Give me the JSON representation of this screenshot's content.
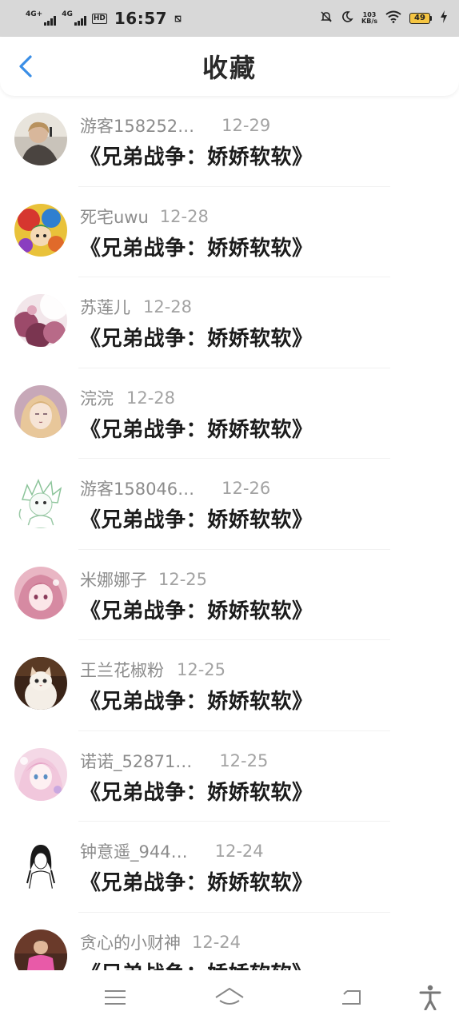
{
  "status_bar": {
    "net1": "4G+",
    "net2": "4G",
    "hd": "HD",
    "time": "16:57",
    "extra": "⧅",
    "speed_value": "103",
    "speed_unit": "KB/s",
    "battery": "49"
  },
  "header": {
    "title": "收藏",
    "back_icon": "chevron-left-icon",
    "accent": "#3a8ee6"
  },
  "items": [
    {
      "user": "游客158252…",
      "date": "12-29",
      "title": "《兄弟战争：娇娇软软》",
      "avatar": "avatar-photo-person"
    },
    {
      "user": "死宅uwu",
      "date": "12-28",
      "title": "《兄弟战争：娇娇软软》",
      "avatar": "avatar-colorful-anime"
    },
    {
      "user": "苏莲儿",
      "date": "12-28",
      "title": "《兄弟战争：娇娇软软》",
      "avatar": "avatar-pink-blossom"
    },
    {
      "user": "浣浣",
      "date": "12-28",
      "title": "《兄弟战争：娇娇软软》",
      "avatar": "avatar-anime-girl"
    },
    {
      "user": "游客158046…",
      "date": "12-26",
      "title": "《兄弟战争：娇娇软软》",
      "avatar": "avatar-sketch-character"
    },
    {
      "user": "米娜娜子",
      "date": "12-25",
      "title": "《兄弟战争：娇娇软软》",
      "avatar": "avatar-pink-anime"
    },
    {
      "user": "王兰花椒粉",
      "date": "12-25",
      "title": "《兄弟战争：娇娇软软》",
      "avatar": "avatar-cat"
    },
    {
      "user": "诺诺_52871…",
      "date": "12-25",
      "title": "《兄弟战争：娇娇软软》",
      "avatar": "avatar-pastel-anime"
    },
    {
      "user": "钟意遥_944…",
      "date": "12-24",
      "title": "《兄弟战争：娇娇软软》",
      "avatar": "avatar-lineart-girl"
    },
    {
      "user": "贪心的小财神",
      "date": "12-24",
      "title": "《兄弟战争：娇娇软软》",
      "avatar": "avatar-pink-outfit"
    }
  ],
  "nav_bar": {
    "icons": [
      "menu-icon",
      "home-icon",
      "back-icon",
      "accessibility-icon"
    ]
  }
}
